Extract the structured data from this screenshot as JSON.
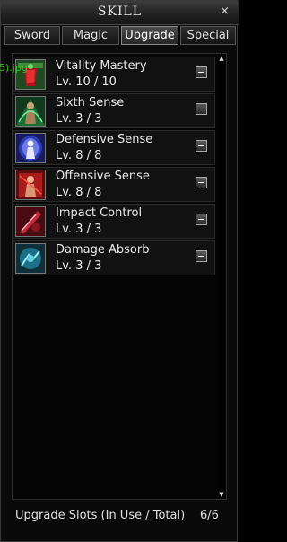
{
  "window": {
    "title": "SKILL",
    "close_glyph": "×"
  },
  "tabs": [
    {
      "label": "Sword",
      "active": false
    },
    {
      "label": "Magic",
      "active": false
    },
    {
      "label": "Upgrade",
      "active": true
    },
    {
      "label": "Special",
      "active": false
    }
  ],
  "overlay_fragment": "5).jpg",
  "skills": [
    {
      "name": "Vitality Mastery",
      "level": "Lv. 10 / 10",
      "icon": "vitality-mastery-icon"
    },
    {
      "name": "Sixth Sense",
      "level": "Lv. 3 / 3",
      "icon": "sixth-sense-icon"
    },
    {
      "name": "Defensive Sense",
      "level": "Lv. 8 / 8",
      "icon": "defensive-sense-icon"
    },
    {
      "name": "Offensive Sense",
      "level": "Lv. 8 / 8",
      "icon": "offensive-sense-icon"
    },
    {
      "name": "Impact Control",
      "level": "Lv. 3 / 3",
      "icon": "impact-control-icon"
    },
    {
      "name": "Damage Absorb",
      "level": "Lv. 3 / 3",
      "icon": "damage-absorb-icon"
    }
  ],
  "footer": {
    "label": "Upgrade Slots (In Use / Total)",
    "value": "6/6"
  },
  "colors": {
    "text": "#eaeaea",
    "fragment_green": "#3fbe2a",
    "panel": "#0a0a0a"
  }
}
